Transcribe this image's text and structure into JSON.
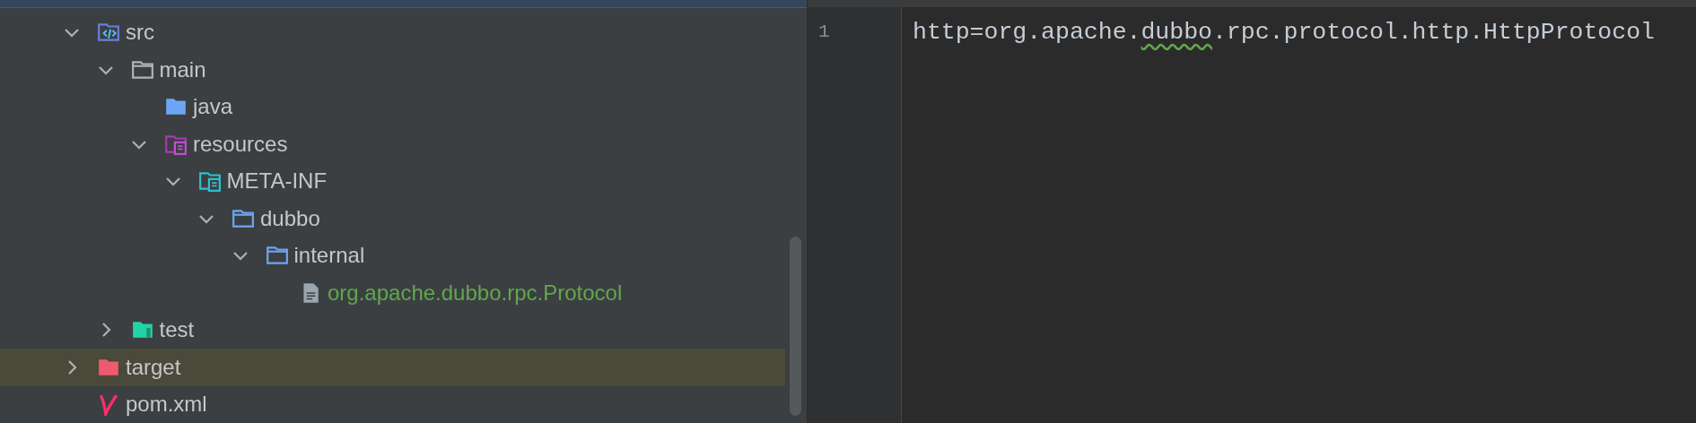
{
  "project_tree": [
    {
      "label": "src",
      "kind": "source-folder",
      "expanded": true,
      "selected": false,
      "added": false,
      "children": [
        {
          "label": "main",
          "kind": "folder",
          "expanded": true,
          "selected": false,
          "added": false,
          "children": [
            {
              "label": "java",
              "kind": "java-folder",
              "selected": false,
              "added": false
            },
            {
              "label": "resources",
              "kind": "resources-folder",
              "expanded": true,
              "selected": false,
              "added": false,
              "children": [
                {
                  "label": "META-INF",
                  "kind": "meta-folder",
                  "expanded": true,
                  "selected": false,
                  "added": false,
                  "children": [
                    {
                      "label": "dubbo",
                      "kind": "package",
                      "expanded": true,
                      "selected": false,
                      "added": false,
                      "children": [
                        {
                          "label": "internal",
                          "kind": "package",
                          "expanded": true,
                          "selected": false,
                          "added": false,
                          "children": [
                            {
                              "label": "org.apache.dubbo.rpc.Protocol",
                              "kind": "file",
                              "selected": false,
                              "added": true
                            }
                          ]
                        }
                      ]
                    }
                  ]
                }
              ]
            }
          ]
        },
        {
          "label": "test",
          "kind": "test-folder",
          "expanded": false,
          "selected": false,
          "added": false
        }
      ]
    },
    {
      "label": "target",
      "kind": "excluded-folder",
      "expanded": false,
      "selected": true,
      "added": false
    },
    {
      "label": "pom.xml",
      "kind": "maven",
      "selected": false,
      "added": false
    }
  ],
  "editor": {
    "lines": [
      {
        "number": "1",
        "segments": [
          {
            "text": "http=org.apache.",
            "typo": false
          },
          {
            "text": "dubbo",
            "typo": true
          },
          {
            "text": ".rpc.protocol.http.HttpProtocol",
            "typo": false
          }
        ]
      }
    ]
  }
}
